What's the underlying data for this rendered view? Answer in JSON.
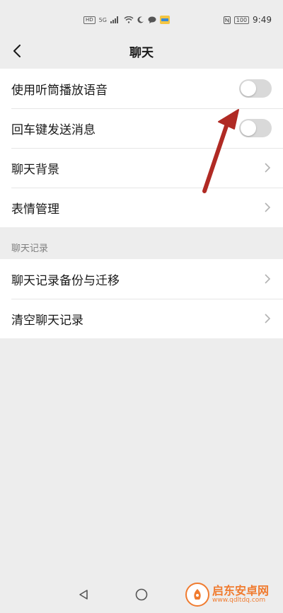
{
  "status_bar": {
    "hd": "HD",
    "signal": "5G",
    "battery": "100",
    "time": "9:49"
  },
  "nav": {
    "title": "聊天"
  },
  "group1": {
    "items": [
      {
        "label": "使用听筒播放语音",
        "control": "toggle",
        "on": false
      },
      {
        "label": "回车键发送消息",
        "control": "toggle",
        "on": false
      },
      {
        "label": "聊天背景",
        "control": "chevron"
      },
      {
        "label": "表情管理",
        "control": "chevron"
      }
    ]
  },
  "section": {
    "header": "聊天记录"
  },
  "group2": {
    "items": [
      {
        "label": "聊天记录备份与迁移",
        "control": "chevron"
      },
      {
        "label": "清空聊天记录",
        "control": "chevron"
      }
    ]
  },
  "watermark": {
    "title": "启东安卓网",
    "url": "www.qdltdq.com"
  },
  "colors": {
    "background": "#ededed",
    "annotation_arrow": "#b02a24",
    "watermark": "#f07b2f"
  }
}
